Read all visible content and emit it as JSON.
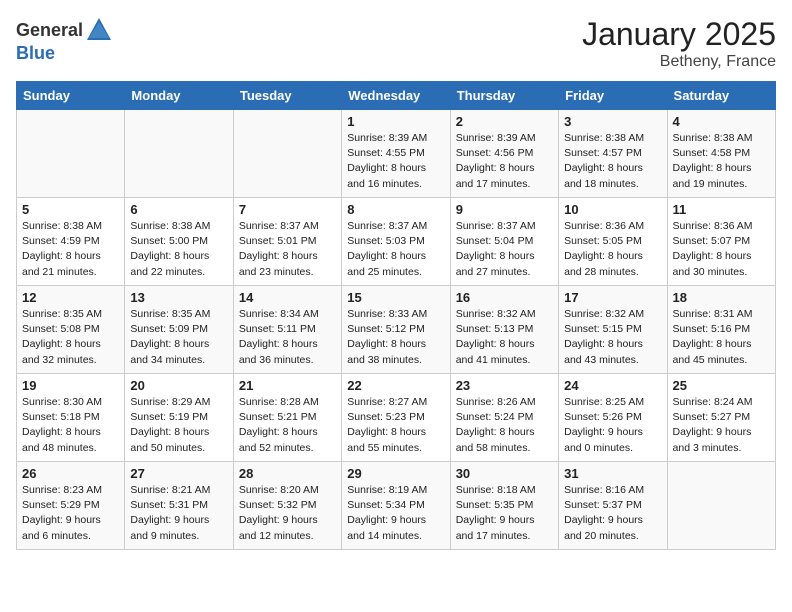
{
  "logo": {
    "general": "General",
    "blue": "Blue"
  },
  "title": "January 2025",
  "subtitle": "Betheny, France",
  "header_days": [
    "Sunday",
    "Monday",
    "Tuesday",
    "Wednesday",
    "Thursday",
    "Friday",
    "Saturday"
  ],
  "weeks": [
    [
      {
        "day": "",
        "info": ""
      },
      {
        "day": "",
        "info": ""
      },
      {
        "day": "",
        "info": ""
      },
      {
        "day": "1",
        "info": "Sunrise: 8:39 AM\nSunset: 4:55 PM\nDaylight: 8 hours\nand 16 minutes."
      },
      {
        "day": "2",
        "info": "Sunrise: 8:39 AM\nSunset: 4:56 PM\nDaylight: 8 hours\nand 17 minutes."
      },
      {
        "day": "3",
        "info": "Sunrise: 8:38 AM\nSunset: 4:57 PM\nDaylight: 8 hours\nand 18 minutes."
      },
      {
        "day": "4",
        "info": "Sunrise: 8:38 AM\nSunset: 4:58 PM\nDaylight: 8 hours\nand 19 minutes."
      }
    ],
    [
      {
        "day": "5",
        "info": "Sunrise: 8:38 AM\nSunset: 4:59 PM\nDaylight: 8 hours\nand 21 minutes."
      },
      {
        "day": "6",
        "info": "Sunrise: 8:38 AM\nSunset: 5:00 PM\nDaylight: 8 hours\nand 22 minutes."
      },
      {
        "day": "7",
        "info": "Sunrise: 8:37 AM\nSunset: 5:01 PM\nDaylight: 8 hours\nand 23 minutes."
      },
      {
        "day": "8",
        "info": "Sunrise: 8:37 AM\nSunset: 5:03 PM\nDaylight: 8 hours\nand 25 minutes."
      },
      {
        "day": "9",
        "info": "Sunrise: 8:37 AM\nSunset: 5:04 PM\nDaylight: 8 hours\nand 27 minutes."
      },
      {
        "day": "10",
        "info": "Sunrise: 8:36 AM\nSunset: 5:05 PM\nDaylight: 8 hours\nand 28 minutes."
      },
      {
        "day": "11",
        "info": "Sunrise: 8:36 AM\nSunset: 5:07 PM\nDaylight: 8 hours\nand 30 minutes."
      }
    ],
    [
      {
        "day": "12",
        "info": "Sunrise: 8:35 AM\nSunset: 5:08 PM\nDaylight: 8 hours\nand 32 minutes."
      },
      {
        "day": "13",
        "info": "Sunrise: 8:35 AM\nSunset: 5:09 PM\nDaylight: 8 hours\nand 34 minutes."
      },
      {
        "day": "14",
        "info": "Sunrise: 8:34 AM\nSunset: 5:11 PM\nDaylight: 8 hours\nand 36 minutes."
      },
      {
        "day": "15",
        "info": "Sunrise: 8:33 AM\nSunset: 5:12 PM\nDaylight: 8 hours\nand 38 minutes."
      },
      {
        "day": "16",
        "info": "Sunrise: 8:32 AM\nSunset: 5:13 PM\nDaylight: 8 hours\nand 41 minutes."
      },
      {
        "day": "17",
        "info": "Sunrise: 8:32 AM\nSunset: 5:15 PM\nDaylight: 8 hours\nand 43 minutes."
      },
      {
        "day": "18",
        "info": "Sunrise: 8:31 AM\nSunset: 5:16 PM\nDaylight: 8 hours\nand 45 minutes."
      }
    ],
    [
      {
        "day": "19",
        "info": "Sunrise: 8:30 AM\nSunset: 5:18 PM\nDaylight: 8 hours\nand 48 minutes."
      },
      {
        "day": "20",
        "info": "Sunrise: 8:29 AM\nSunset: 5:19 PM\nDaylight: 8 hours\nand 50 minutes."
      },
      {
        "day": "21",
        "info": "Sunrise: 8:28 AM\nSunset: 5:21 PM\nDaylight: 8 hours\nand 52 minutes."
      },
      {
        "day": "22",
        "info": "Sunrise: 8:27 AM\nSunset: 5:23 PM\nDaylight: 8 hours\nand 55 minutes."
      },
      {
        "day": "23",
        "info": "Sunrise: 8:26 AM\nSunset: 5:24 PM\nDaylight: 8 hours\nand 58 minutes."
      },
      {
        "day": "24",
        "info": "Sunrise: 8:25 AM\nSunset: 5:26 PM\nDaylight: 9 hours\nand 0 minutes."
      },
      {
        "day": "25",
        "info": "Sunrise: 8:24 AM\nSunset: 5:27 PM\nDaylight: 9 hours\nand 3 minutes."
      }
    ],
    [
      {
        "day": "26",
        "info": "Sunrise: 8:23 AM\nSunset: 5:29 PM\nDaylight: 9 hours\nand 6 minutes."
      },
      {
        "day": "27",
        "info": "Sunrise: 8:21 AM\nSunset: 5:31 PM\nDaylight: 9 hours\nand 9 minutes."
      },
      {
        "day": "28",
        "info": "Sunrise: 8:20 AM\nSunset: 5:32 PM\nDaylight: 9 hours\nand 12 minutes."
      },
      {
        "day": "29",
        "info": "Sunrise: 8:19 AM\nSunset: 5:34 PM\nDaylight: 9 hours\nand 14 minutes."
      },
      {
        "day": "30",
        "info": "Sunrise: 8:18 AM\nSunset: 5:35 PM\nDaylight: 9 hours\nand 17 minutes."
      },
      {
        "day": "31",
        "info": "Sunrise: 8:16 AM\nSunset: 5:37 PM\nDaylight: 9 hours\nand 20 minutes."
      },
      {
        "day": "",
        "info": ""
      }
    ]
  ]
}
